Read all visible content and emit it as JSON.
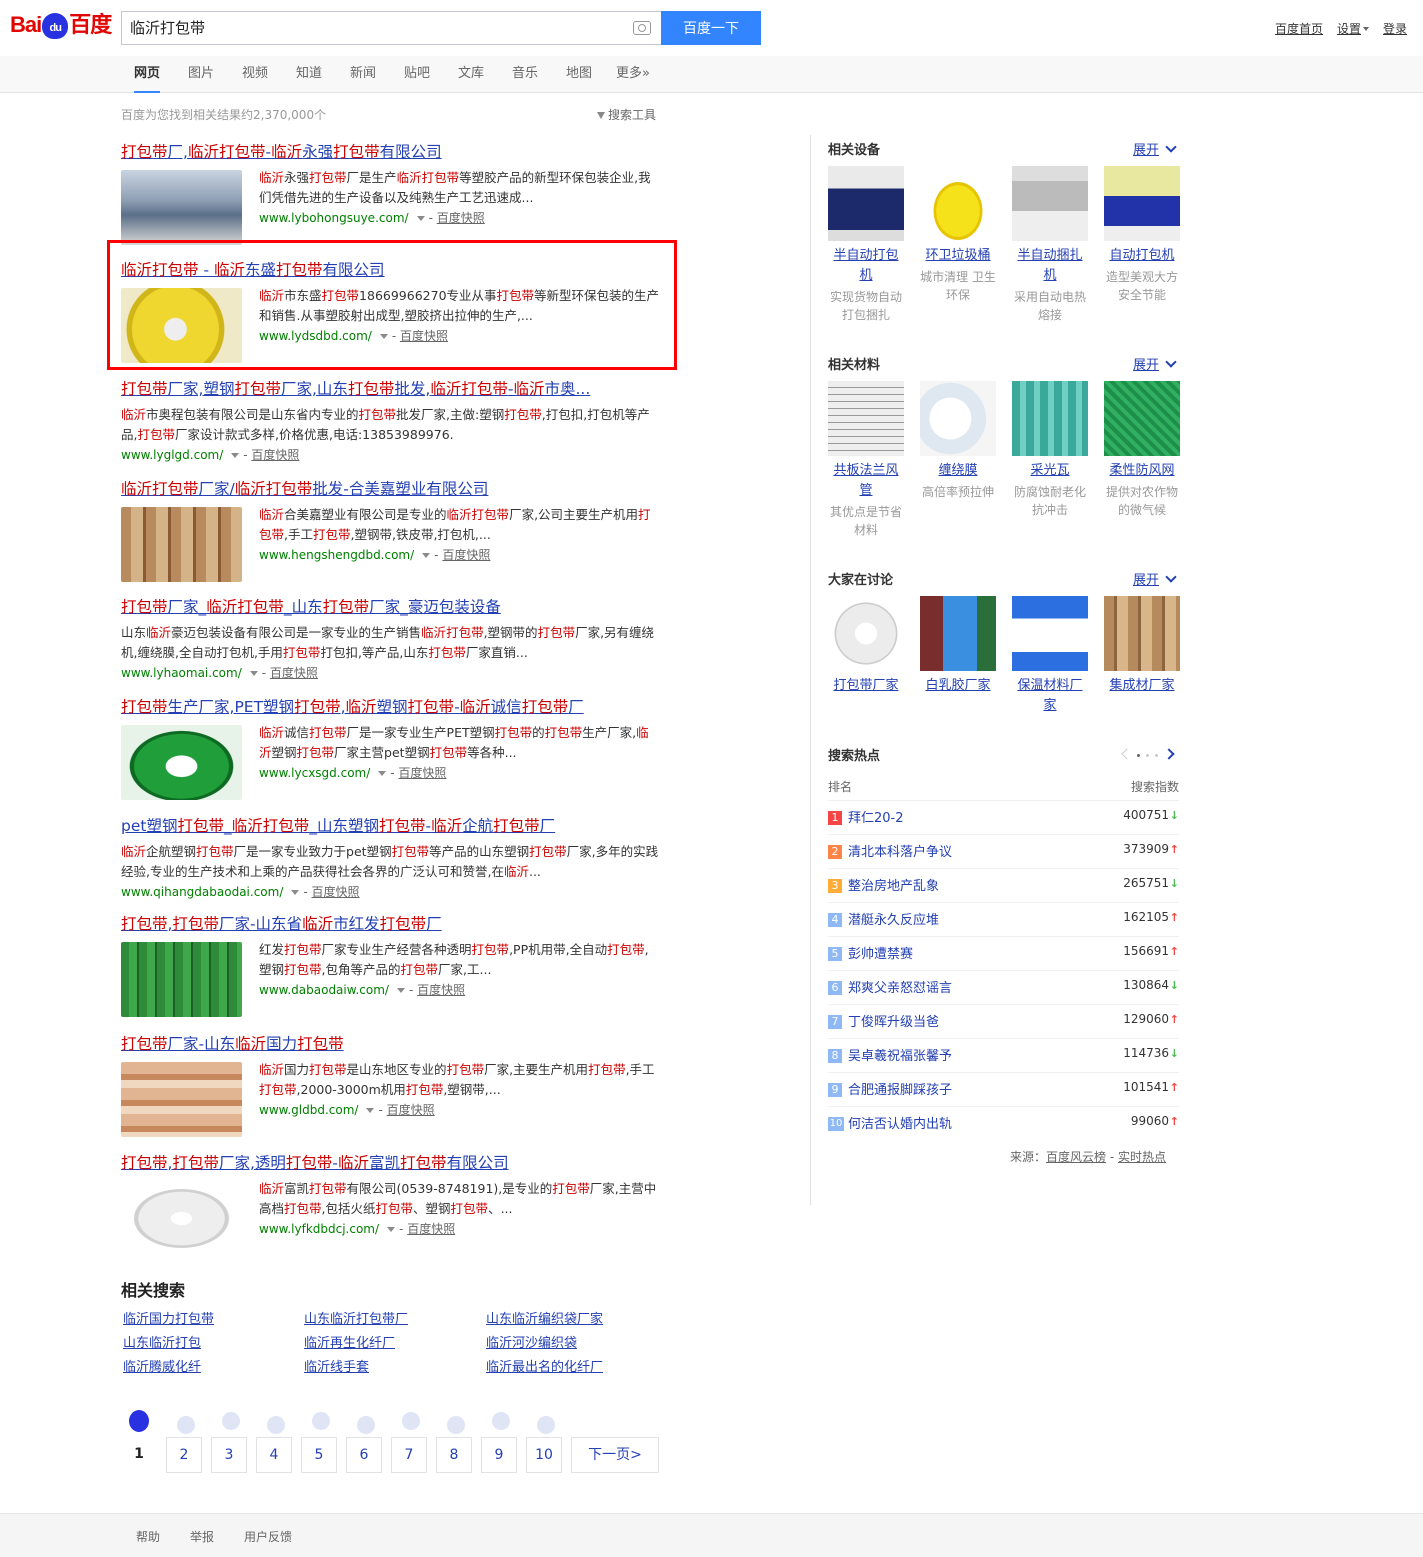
{
  "header": {
    "logo_left": "Bai",
    "logo_paw": "du",
    "logo_right": "百度",
    "search_query": "临沂打包带",
    "search_button": "百度一下",
    "links": [
      "百度首页",
      "设置",
      "登录"
    ]
  },
  "tabs": [
    "网页",
    "图片",
    "视频",
    "知道",
    "新闻",
    "贴吧",
    "文库",
    "音乐",
    "地图",
    "更多»"
  ],
  "info": "百度为您找到相关结果约2,370,000个",
  "tools": "搜索工具",
  "results": [
    {
      "title": "打包带厂,临沂打包带-临沂永强打包带有限公司",
      "abs": "临沂永强打包带厂是生产临沂打包带等塑胶产品的新型环保包装企业,我们凭借先进的生产设备以及纯熟生产工艺迅速成...",
      "url": "www.lybohongsuye.com/",
      "snap": "百度快照"
    },
    {
      "title": "临沂打包带 - 临沂东盛打包带有限公司",
      "abs": "临沂市东盛打包带18669966270专业从事打包带等新型环保包装的生产和销售.从事塑胶射出成型,塑胶挤出拉伸的生产,...",
      "url": "www.lydsdbd.com/",
      "snap": "百度快照"
    },
    {
      "title": "打包带厂家,塑钢打包带厂家,山东打包带批发,临沂打包带-临沂市奥...",
      "abs": "临沂市奥程包装有限公司是山东省内专业的打包带批发厂家,主做:塑钢打包带,打包扣,打包机等产品,打包带厂家设计款式多样,价格优惠,电话:13853989976.",
      "url": "www.lyglgd.com/",
      "snap": "百度快照"
    },
    {
      "title": "临沂打包带厂家/临沂打包带批发-合美嘉塑业有限公司",
      "abs": "临沂合美嘉塑业有限公司是专业的临沂打包带厂家,公司主要生产机用打包带,手工打包带,塑钢带,铁皮带,打包机,...",
      "url": "www.hengshengdbd.com/",
      "snap": "百度快照"
    },
    {
      "title": "打包带厂家_临沂打包带_山东打包带厂家_豪迈包装设备",
      "abs": "山东临沂豪迈包装设备有限公司是一家专业的生产销售临沂打包带,塑钢带的打包带厂家,另有缠绕机,缠绕膜,全自动打包机,手用打包带打包扣,等产品,山东打包带厂家直销...",
      "url": "www.lyhaomai.com/",
      "snap": "百度快照"
    },
    {
      "title": "打包带生产厂家,PET塑钢打包带,临沂塑钢打包带-临沂诚信打包带厂",
      "abs": "临沂诚信打包带厂是一家专业生产PET塑钢打包带的打包带生产厂家,临沂塑钢打包带厂家主营pet塑钢打包带等各种...",
      "url": "www.lycxsgd.com/",
      "snap": "百度快照"
    },
    {
      "title": "pet塑钢打包带_临沂打包带_山东塑钢打包带-临沂企航打包带厂",
      "abs": "临沂企航塑钢打包带厂是一家专业致力于pet塑钢打包带等产品的山东塑钢打包带厂家,多年的实践经验,专业的生产技术和上乘的产品获得社会各界的广泛认可和赞誉,在临沂...",
      "url": "www.qihangdabaodai.com/",
      "snap": "百度快照"
    },
    {
      "title": "打包带,打包带厂家-山东省临沂市红发打包带厂",
      "abs": "红发打包带厂家专业生产经营各种透明打包带,PP机用带,全自动打包带,塑钢打包带,包角等产品的打包带厂家,工...",
      "url": "www.dabaodaiw.com/",
      "snap": "百度快照"
    },
    {
      "title": "打包带厂家-山东临沂国力打包带",
      "abs": "临沂国力打包带是山东地区专业的打包带厂家,主要生产机用打包带,手工打包带,2000-3000m机用打包带,塑钢带,...",
      "url": "www.gldbd.com/",
      "snap": "百度快照"
    },
    {
      "title": "打包带,打包带厂家,透明打包带-临沂富凯打包带有限公司",
      "abs": "临沂富凯打包带有限公司(0539-8748191),是专业的打包带厂家,主营中高档打包带,包括火纸打包带、塑钢打包带、...",
      "url": "www.lyfkdbdcj.com/",
      "snap": "百度快照"
    }
  ],
  "related": {
    "title": "相关搜索",
    "items": [
      "临沂国力打包带",
      "山东临沂打包带厂",
      "山东临沂编织袋厂家",
      "山东临沂打包",
      "临沂再生化纤厂",
      "临沂河沙编织袋",
      "临沂腾威化纤",
      "临沂线手套",
      "临沂最出名的化纤厂"
    ]
  },
  "pager": {
    "pages": [
      "1",
      "2",
      "3",
      "4",
      "5",
      "6",
      "7",
      "8",
      "9",
      "10"
    ],
    "next": "下一页>"
  },
  "footer": [
    "帮助",
    "举报",
    "用户反馈"
  ],
  "right": {
    "expand": "展开",
    "sections": [
      {
        "title": "相关设备",
        "cards": [
          {
            "name": "半自动打包机",
            "desc": "实现货物自动打包捆扎"
          },
          {
            "name": "环卫垃圾桶",
            "desc": "城市清理 卫生环保"
          },
          {
            "name": "半自动捆扎机",
            "desc": "采用自动电热熔接"
          },
          {
            "name": "自动打包机",
            "desc": "造型美观大方安全节能"
          }
        ]
      },
      {
        "title": "相关材料",
        "cards": [
          {
            "name": "共板法兰风管",
            "desc": "其优点是节省材料"
          },
          {
            "name": "缠绕膜",
            "desc": "高倍率预拉伸"
          },
          {
            "name": "采光瓦",
            "desc": "防腐蚀耐老化抗冲击"
          },
          {
            "name": "柔性防风网",
            "desc": "提供对农作物的微气候"
          }
        ]
      },
      {
        "title": "大家在讨论",
        "cards": [
          {
            "name": "打包带厂家",
            "desc": ""
          },
          {
            "name": "白乳胶厂家",
            "desc": ""
          },
          {
            "name": "保温材料厂家",
            "desc": ""
          },
          {
            "name": "集成材厂家",
            "desc": ""
          }
        ]
      }
    ],
    "hot": {
      "title": "搜索热点",
      "col_rank": "排名",
      "col_index": "搜索指数",
      "items": [
        {
          "rank": "1",
          "word": "拜仁20-2",
          "value": "400751",
          "trend": "down"
        },
        {
          "rank": "2",
          "word": "清北本科落户争议",
          "value": "373909",
          "trend": "up"
        },
        {
          "rank": "3",
          "word": "整治房地产乱象",
          "value": "265751",
          "trend": "down"
        },
        {
          "rank": "4",
          "word": "潜艇永久反应堆",
          "value": "162105",
          "trend": "up"
        },
        {
          "rank": "5",
          "word": "彭帅遭禁赛",
          "value": "156691",
          "trend": "up"
        },
        {
          "rank": "6",
          "word": "郑爽父亲怒怼谣言",
          "value": "130864",
          "trend": "down"
        },
        {
          "rank": "7",
          "word": "丁俊晖升级当爸",
          "value": "129060",
          "trend": "up"
        },
        {
          "rank": "8",
          "word": "吴卓羲祝福张馨予",
          "value": "114736",
          "trend": "down"
        },
        {
          "rank": "9",
          "word": "合肥通报脚踩孩子",
          "value": "101541",
          "trend": "up"
        },
        {
          "rank": "10",
          "word": "何洁否认婚内出轨",
          "value": "99060",
          "trend": "up"
        }
      ],
      "source_label": "来源：",
      "source_1": "百度风云榜",
      "source_sep": " - ",
      "source_2": "实时热点"
    },
    "colors": {
      "rank_1": "#f54545",
      "rank_2": "#ff8547",
      "rank_3": "#ffac38",
      "rank_other": "#8eb9f5",
      "up": "#f54545",
      "down": "#4ebb52"
    }
  }
}
